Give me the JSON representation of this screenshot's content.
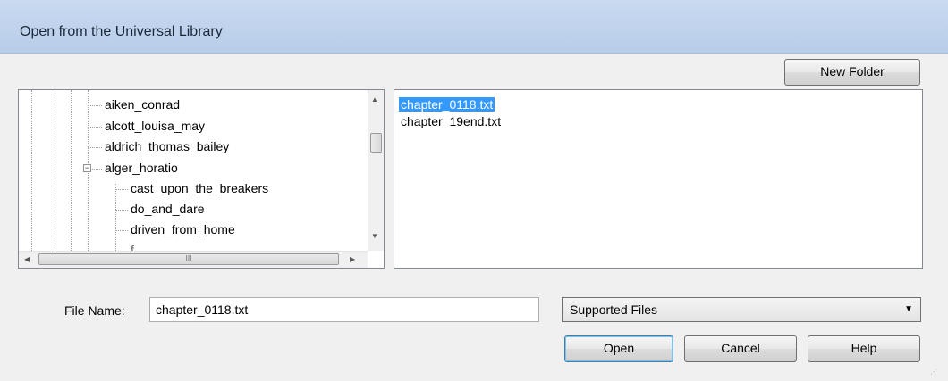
{
  "window": {
    "title": "Open from the Universal Library"
  },
  "toolbar": {
    "new_folder_label": "New Folder"
  },
  "tree": {
    "items": [
      {
        "label": "aiken_conrad"
      },
      {
        "label": "alcott_louisa_may"
      },
      {
        "label": "aldrich_thomas_bailey"
      },
      {
        "label": "alger_horatio",
        "expanded": true
      },
      {
        "label": "cast_upon_the_breakers"
      },
      {
        "label": "do_and_dare"
      },
      {
        "label": "driven_from_home"
      }
    ],
    "hscroll_glyph": "III"
  },
  "files": {
    "items": [
      {
        "label": "chapter_0118.txt",
        "selected": true
      },
      {
        "label": "chapter_19end.txt",
        "selected": false
      }
    ]
  },
  "form": {
    "filename_label": "File Name:",
    "filename_value": "chapter_0118.txt",
    "filetype_value": "Supported Files"
  },
  "buttons": {
    "open": "Open",
    "cancel": "Cancel",
    "help": "Help"
  },
  "colors": {
    "selection": "#3399ff",
    "titlebar": "#c9daf0",
    "client": "#f0f0f0"
  }
}
